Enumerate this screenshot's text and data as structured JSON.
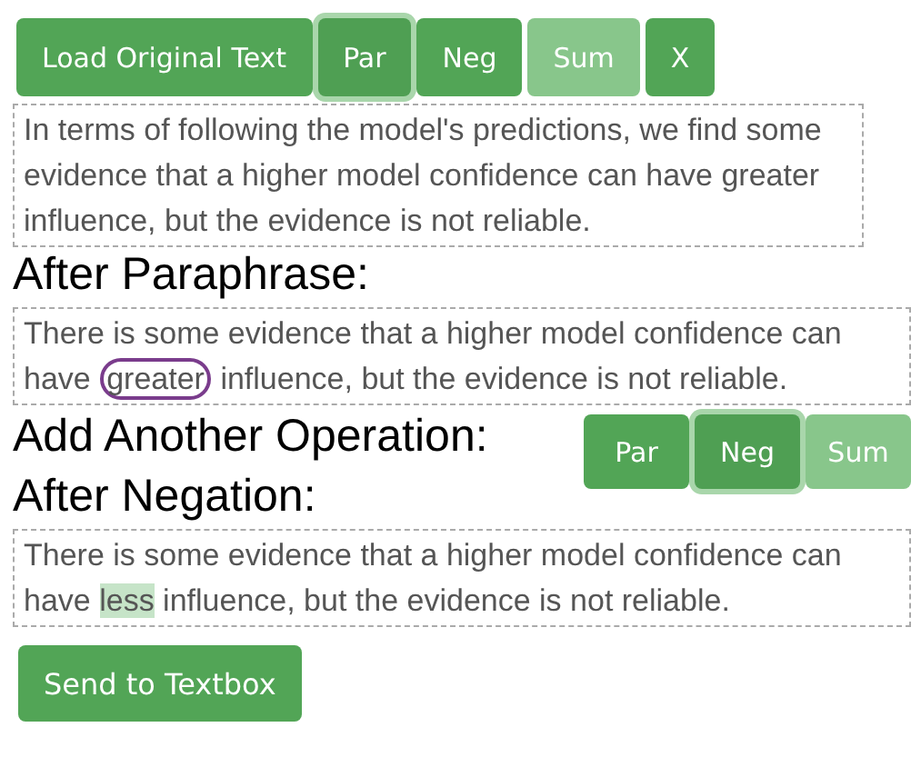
{
  "toolbar": [
    {
      "label": "Load Original Text",
      "selected": false,
      "disabled": false
    },
    {
      "label": "Par",
      "selected": true,
      "disabled": false
    },
    {
      "label": "Neg",
      "selected": false,
      "disabled": false
    },
    {
      "label": "Sum",
      "selected": false,
      "disabled": true
    },
    {
      "label": "X",
      "selected": false,
      "disabled": false
    }
  ],
  "original_text": {
    "text": "In terms of following the model's predictions, we find some evidence that a higher model confidence can have greater influence, but the evidence is not reliable."
  },
  "paraphrase": {
    "heading": "After Paraphrase:",
    "segments": [
      {
        "kind": "plain",
        "text": "There is some evidence that a higher model confidence can have "
      },
      {
        "kind": "circled",
        "text": "greater"
      },
      {
        "kind": "plain",
        "text": " influence, but the evidence is not reliable."
      }
    ]
  },
  "add_operation": {
    "heading": "Add Another Operation:",
    "buttons": [
      {
        "label": "Par",
        "selected": false,
        "disabled": false
      },
      {
        "label": "Neg",
        "selected": true,
        "disabled": false
      },
      {
        "label": "Sum",
        "selected": false,
        "disabled": true
      }
    ]
  },
  "negation": {
    "heading": "After Negation:",
    "segments": [
      {
        "kind": "plain",
        "text": "There is some evidence that a higher model confidence can have "
      },
      {
        "kind": "highlighted",
        "text": "less"
      },
      {
        "kind": "plain",
        "text": " influence, but the evidence is not reliable."
      }
    ]
  },
  "send_button": {
    "label": "Send to Textbox"
  }
}
